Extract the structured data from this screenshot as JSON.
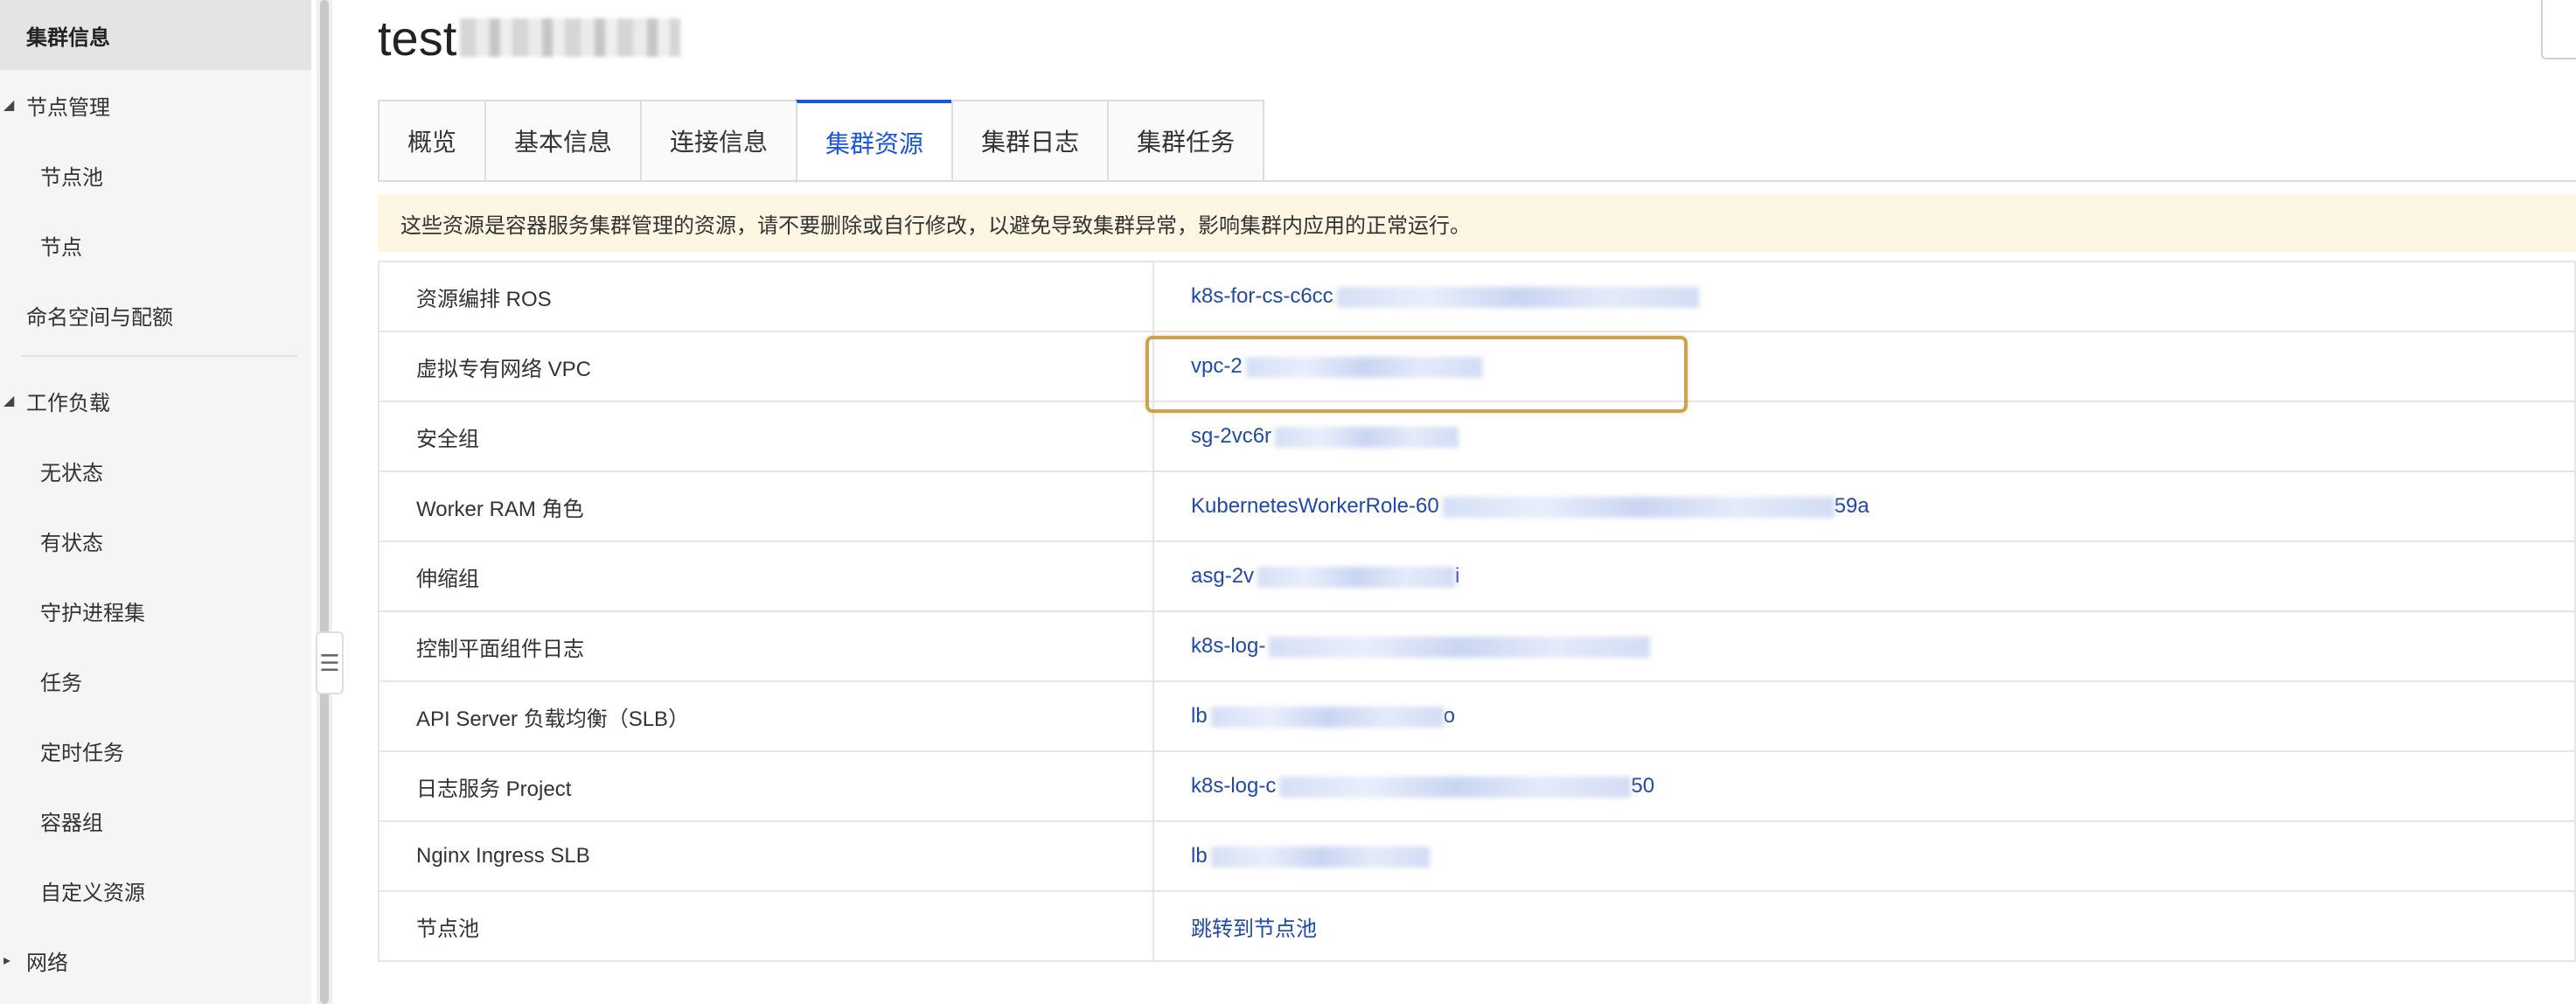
{
  "sidebar": {
    "items": [
      {
        "label": "集群信息",
        "active": true,
        "caret": ""
      },
      {
        "label": "节点管理",
        "active": false,
        "caret": "◢"
      },
      {
        "label": "节点池",
        "active": false,
        "caret": ""
      },
      {
        "label": "节点",
        "active": false,
        "caret": ""
      },
      {
        "label": "命名空间与配额",
        "active": false,
        "caret": ""
      },
      {
        "label": "工作负载",
        "active": false,
        "caret": "◢"
      },
      {
        "label": "无状态",
        "active": false,
        "caret": ""
      },
      {
        "label": "有状态",
        "active": false,
        "caret": ""
      },
      {
        "label": "守护进程集",
        "active": false,
        "caret": ""
      },
      {
        "label": "任务",
        "active": false,
        "caret": ""
      },
      {
        "label": "定时任务",
        "active": false,
        "caret": ""
      },
      {
        "label": "容器组",
        "active": false,
        "caret": ""
      },
      {
        "label": "自定义资源",
        "active": false,
        "caret": ""
      },
      {
        "label": "网络",
        "active": false,
        "caret": "▸"
      }
    ],
    "collapse_glyph": "☰"
  },
  "header": {
    "title": "test"
  },
  "tabs": [
    {
      "label": "概览",
      "active": false
    },
    {
      "label": "基本信息",
      "active": false
    },
    {
      "label": "连接信息",
      "active": false
    },
    {
      "label": "集群资源",
      "active": true
    },
    {
      "label": "集群日志",
      "active": false
    },
    {
      "label": "集群任务",
      "active": false
    }
  ],
  "notice": "这些资源是容器服务集群管理的资源，请不要删除或自行修改，以避免导致集群异常，影响集群内应用的正常运行。",
  "resources": [
    {
      "label": "资源编排 ROS",
      "value": "k8s-for-cs-c6cc",
      "suffix": ""
    },
    {
      "label": "虚拟专有网络 VPC",
      "value": "vpc-2",
      "suffix": ""
    },
    {
      "label": "安全组",
      "value": "sg-2vc6r",
      "suffix": ""
    },
    {
      "label": "Worker RAM 角色",
      "value": "KubernetesWorkerRole-60",
      "suffix": "59a"
    },
    {
      "label": "伸缩组",
      "value": "asg-2v",
      "suffix": "i"
    },
    {
      "label": "控制平面组件日志",
      "value": "k8s-log-",
      "suffix": ""
    },
    {
      "label": "API Server 负载均衡（SLB）",
      "value": "lb",
      "suffix": "o"
    },
    {
      "label": "日志服务 Project",
      "value": "k8s-log-c",
      "suffix": "50"
    },
    {
      "label": "Nginx Ingress SLB",
      "value": "lb",
      "suffix": ""
    },
    {
      "label": "节点池",
      "value": "跳转到节点池",
      "suffix": ""
    }
  ],
  "colors": {
    "accent": "#1a56db",
    "link": "#1f4aa8",
    "notice_bg": "#fdf6e3",
    "highlight_border": "#c9a350",
    "sidebar_bg": "#f5f5f5"
  }
}
